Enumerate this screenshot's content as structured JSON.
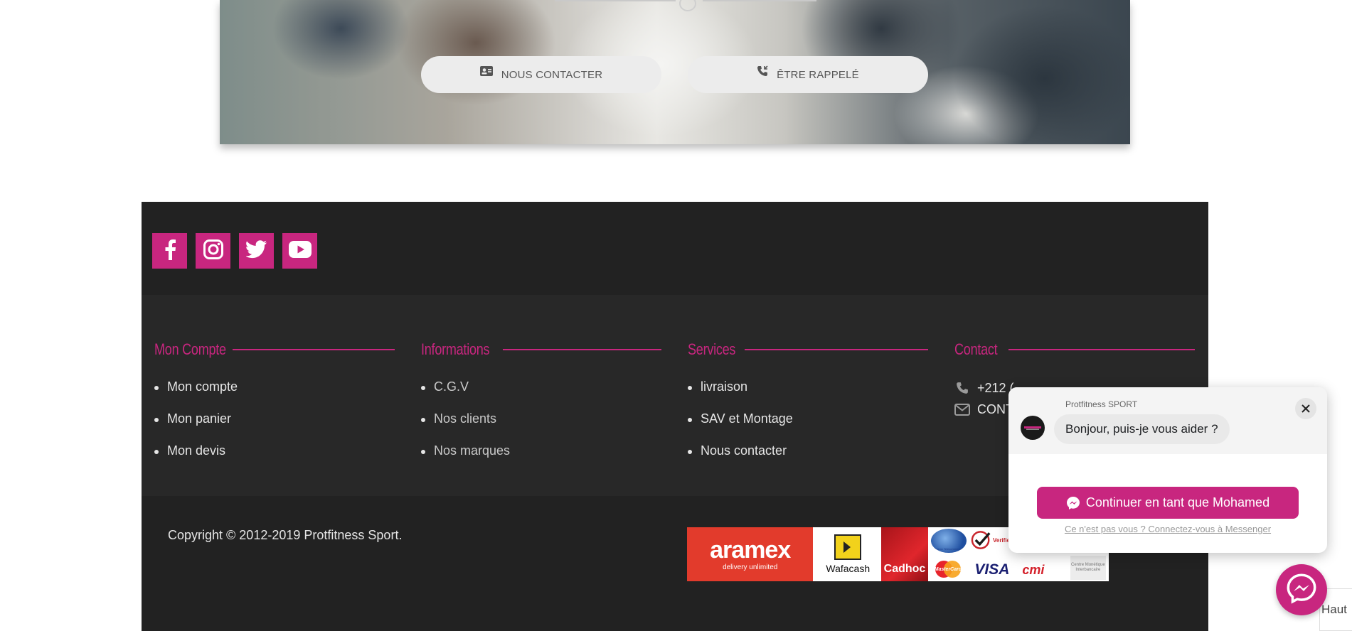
{
  "hero": {
    "contact_button": "NOUS CONTACTER",
    "callback_button": "ÊTRE RAPPELÉ"
  },
  "social": [
    "facebook-icon",
    "instagram-icon",
    "twitter-icon",
    "youtube-icon"
  ],
  "footer": {
    "mon_compte": {
      "title": "Mon Compte",
      "items": [
        "Mon compte",
        "Mon panier",
        "Mon devis"
      ]
    },
    "informations": {
      "title": "Informations",
      "items": [
        "C.G.V",
        "Nos clients",
        "Nos marques"
      ]
    },
    "services": {
      "title": "Services",
      "items": [
        "livraison",
        "SAV et Montage",
        "Nous contacter"
      ]
    },
    "contact": {
      "title": "Contact",
      "phone": "+212 (",
      "email": "CONT"
    },
    "copyright": "Copyright © 2012-2019 Protfitness Sport.",
    "payments": {
      "aramex": "aramex",
      "aramex_tagline": "delivery unlimited",
      "wafacash": "Wafacash",
      "cadhoc": "Cadhoc",
      "visa": "VISA",
      "cmi": "cmi",
      "mastercard": "MasterCard",
      "centre": "Centre Monétique Interbancaire",
      "maroc_telecommerce": "Maroc Telecommerce",
      "verified": "Verified"
    }
  },
  "chat": {
    "page_name": "Protfitness SPORT",
    "greeting": "Bonjour, puis-je vous aider ?",
    "continue_button": "Continuer en tant que Mohamed",
    "alt_link": "Ce n'est pas vous ? Connectez-vous à Messenger"
  },
  "back_to_top": "Haut",
  "colors": {
    "accent": "#c8267f",
    "footer_bg": "#222222",
    "footer_links_bg": "#282828"
  }
}
